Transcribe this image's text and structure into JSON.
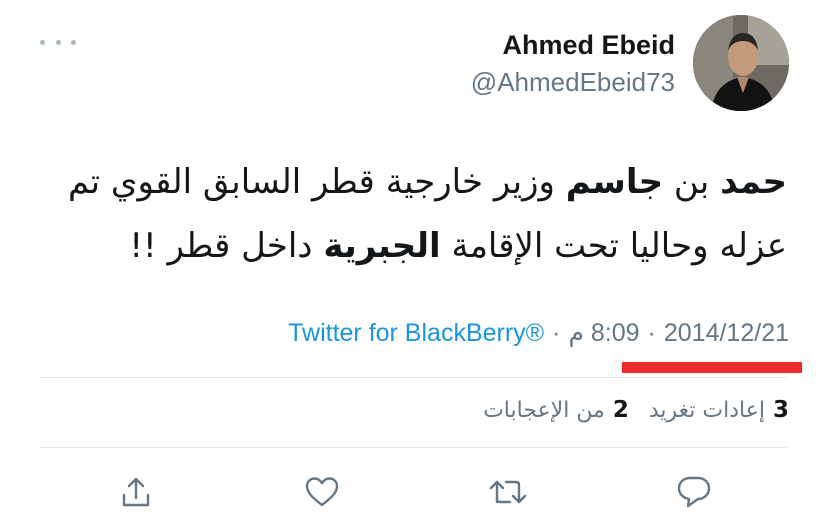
{
  "tweet": {
    "author": {
      "display_name": "Ahmed Ebeid",
      "handle": "@AhmedEbeid73"
    },
    "text": {
      "line1_part1": "حمد",
      "line1_part2": " بن ",
      "line1_part3": "جاسم",
      "line1_part4": " وزير خارجية قطر السابق القوي تم",
      "line2_part1": "عزله وحاليا تحت الإقامة ",
      "line2_part2": "الجبرية",
      "line2_part3": " داخل قطر !!"
    },
    "meta": {
      "date": "2014/12/21",
      "time": "8:09 م",
      "separator": "·",
      "source": "Twitter for BlackBerry®"
    },
    "stats": {
      "retweets_count": "3",
      "retweets_label": "إعادات تغريد",
      "likes_count": "2",
      "likes_label": "من الإعجابات"
    }
  },
  "colors": {
    "accent": "#1b95e0",
    "muted": "#657786",
    "highlight_underline": "#ef2a2a",
    "divider": "#e1e8ed"
  },
  "icons": {
    "more": "more-dots-icon",
    "reply": "reply-icon",
    "retweet": "retweet-icon",
    "like": "heart-icon",
    "share": "share-icon"
  }
}
